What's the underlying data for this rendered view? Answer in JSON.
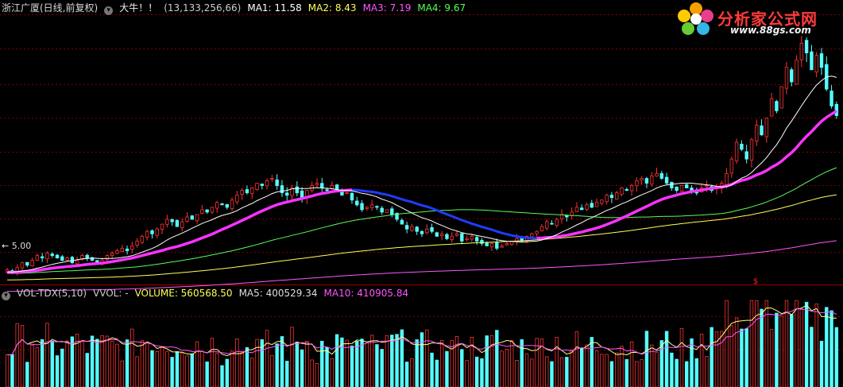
{
  "header": {
    "stock": "浙江广厦(日线,前复权)",
    "indicator": "大牛！！",
    "params": "(13,133,256,66)",
    "ma1": "MA1: 11.58",
    "ma2": "MA2: 8.43",
    "ma3": "MA3: 7.19",
    "ma4": "MA4: 9.67"
  },
  "vol_header": {
    "name": "VOL-TDX(5,10)",
    "vvol": "VVOL: -",
    "volume": "VOLUME: 560568.50",
    "ma5": "MA5: 400529.34",
    "ma10": "MA10: 410905.84"
  },
  "low_label": "5.00",
  "marker": "$",
  "logo": {
    "brand": "分析家公式网",
    "url": "www.88gs.com"
  },
  "colors": {
    "up": "#ff3232",
    "down": "#54ffff",
    "ma1": "#ffffff",
    "ma2": "#ffff55",
    "ma3": "#ff55ff",
    "ma4": "#55ff55",
    "indicator": "#ff33ff",
    "grid": "#7a0000"
  },
  "chart_data": {
    "type": "candlestick",
    "ylim": [
      4.6,
      15.8
    ],
    "grid": true,
    "closes": [
      5.2,
      5.1,
      5.3,
      5.5,
      5.4,
      5.6,
      5.8,
      5.7,
      5.9,
      5.8,
      5.7,
      5.6,
      5.7,
      5.5,
      5.6,
      5.8,
      5.7,
      5.6,
      5.5,
      5.6,
      5.8,
      5.9,
      6.0,
      6.1,
      6.0,
      6.2,
      6.4,
      6.6,
      6.8,
      6.7,
      6.9,
      7.1,
      7.3,
      7.2,
      7.0,
      7.2,
      7.4,
      7.3,
      7.5,
      7.7,
      7.6,
      7.8,
      8.0,
      7.9,
      7.8,
      8.1,
      8.3,
      8.5,
      8.4,
      8.6,
      8.8,
      8.7,
      8.9,
      9.0,
      8.7,
      8.4,
      8.3,
      8.6,
      8.4,
      8.2,
      8.5,
      8.7,
      8.8,
      8.6,
      8.5,
      8.7,
      8.5,
      8.3,
      8.4,
      8.1,
      7.9,
      7.7,
      7.8,
      7.9,
      7.8,
      7.6,
      7.7,
      7.5,
      7.3,
      7.1,
      6.9,
      7.0,
      6.8,
      6.7,
      6.9,
      6.8,
      6.6,
      6.7,
      6.5,
      6.6,
      6.7,
      6.4,
      6.5,
      6.6,
      6.4,
      6.3,
      6.2,
      6.3,
      6.1,
      6.2,
      6.3,
      6.4,
      6.5,
      6.4,
      6.6,
      6.7,
      6.8,
      7.0,
      7.2,
      7.1,
      7.3,
      7.5,
      7.4,
      7.6,
      7.8,
      7.7,
      7.9,
      7.8,
      8.0,
      8.1,
      8.3,
      8.2,
      8.4,
      8.6,
      8.5,
      8.7,
      8.9,
      9.0,
      8.8,
      9.1,
      9.2,
      9.0,
      8.8,
      8.6,
      8.5,
      8.7,
      8.6,
      8.5,
      8.4,
      8.6,
      8.7,
      8.5,
      8.6,
      8.8,
      9.2,
      9.8,
      10.5,
      10.2,
      9.8,
      10.6,
      11.2,
      10.8,
      11.5,
      12.3,
      11.8,
      12.8,
      13.6,
      13.0,
      13.9,
      14.6,
      14.2,
      13.5,
      14.1,
      13.6,
      12.7,
      12.0,
      11.6
    ],
    "ma_periods": [
      13,
      66,
      133,
      256
    ],
    "volume_ylim": [
      0,
      620000
    ],
    "annotations": [
      "5.00",
      "$"
    ]
  }
}
